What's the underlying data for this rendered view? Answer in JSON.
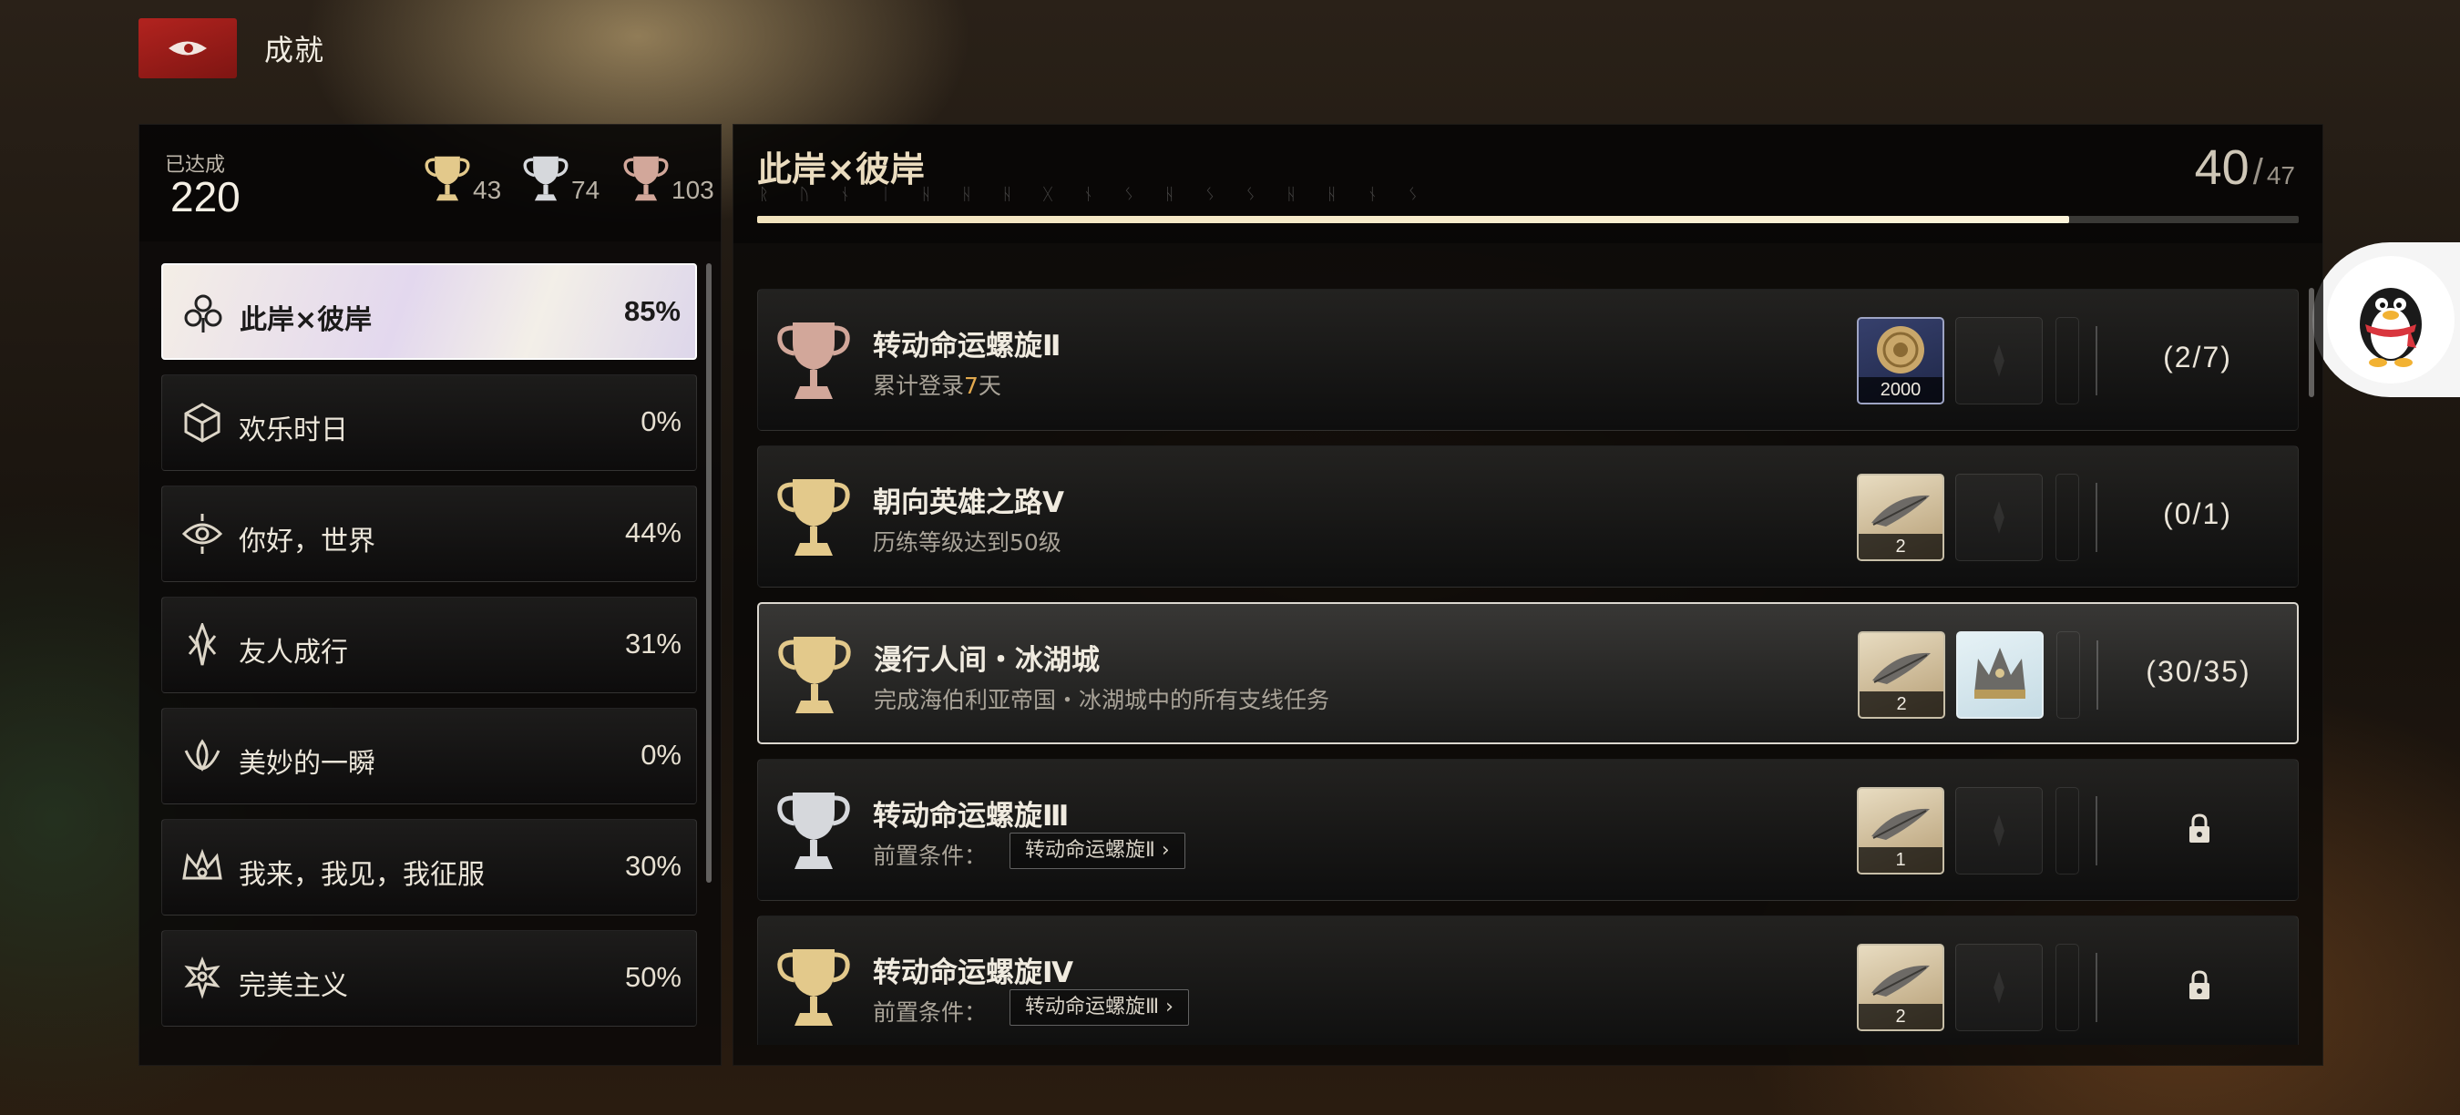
{
  "topbar": {
    "title": "成就"
  },
  "summary": {
    "label": "已达成",
    "total": "220",
    "gold_count": "43",
    "silver_count": "74",
    "bronze_count": "103"
  },
  "categories": [
    {
      "name": "此岸×彼岸",
      "percent": "85%",
      "icon": "clover-star-icon",
      "active": true
    },
    {
      "name": "欢乐时日",
      "percent": "0%",
      "icon": "dice-icon",
      "active": false
    },
    {
      "name": "你好，世界",
      "percent": "44%",
      "icon": "compass-eye-icon",
      "active": false
    },
    {
      "name": "友人成行",
      "percent": "31%",
      "icon": "blade-crest-icon",
      "active": false
    },
    {
      "name": "美妙的一瞬",
      "percent": "0%",
      "icon": "lotus-icon",
      "active": false
    },
    {
      "name": "我来，我见，我征服",
      "percent": "30%",
      "icon": "crown-icon",
      "active": false
    },
    {
      "name": "完美主义",
      "percent": "50%",
      "icon": "ornament-icon",
      "active": false
    }
  ],
  "header": {
    "title": "此岸×彼岸",
    "runes": "ᚱ ᚢ ᚾ ᛁ ᚺ ᚺ ᚺ ᚷ   ᚾ ᛊ ᚺ   ᛊ ᛊ ᚺ ᚺ ᚾ ᛊ",
    "completed": "40",
    "separator": "/",
    "total": "47",
    "progress": 0.851
  },
  "achievements": [
    {
      "name": "转动命运螺旋Ⅱ",
      "desc_pre": "累计登录",
      "desc_hl": "7",
      "desc_post": "天",
      "trophy": "bronze",
      "reward1": {
        "kind": "coin",
        "qty": "2000",
        "icon": "gold-coin-icon"
      },
      "reward2": {
        "kind": "empty",
        "icon": "empty-slot-icon"
      },
      "progress": "(2/7)",
      "locked": false,
      "selected": false
    },
    {
      "name": "朝向英雄之路Ⅴ",
      "desc": "历练等级达到50级",
      "trophy": "gold",
      "reward1": {
        "kind": "item",
        "qty": "2",
        "icon": "feather-quill-icon"
      },
      "reward2": {
        "kind": "empty",
        "icon": "empty-slot-icon"
      },
      "progress": "(0/1)",
      "locked": false,
      "selected": false
    },
    {
      "name": "漫行人间・冰湖城",
      "desc": "完成海伯利亚帝国・冰湖城中的所有支线任务",
      "trophy": "gold",
      "reward1": {
        "kind": "item",
        "qty": "2",
        "icon": "feather-quill-icon"
      },
      "reward2": {
        "kind": "crown",
        "icon": "ice-crown-icon"
      },
      "progress": "(30/35)",
      "locked": false,
      "selected": true
    },
    {
      "name": "转动命运螺旋Ⅲ",
      "prereq_label": "前置条件：",
      "prereq": "转动命运螺旋Ⅱ ›",
      "trophy": "silver",
      "reward1": {
        "kind": "item",
        "qty": "1",
        "icon": "feather-quill-icon"
      },
      "reward2": {
        "kind": "empty",
        "icon": "empty-slot-icon"
      },
      "locked": true,
      "selected": false
    },
    {
      "name": "转动命运螺旋Ⅳ",
      "prereq_label": "前置条件：",
      "prereq": "转动命运螺旋Ⅲ ›",
      "trophy": "gold",
      "reward1": {
        "kind": "item",
        "qty": "2",
        "icon": "feather-quill-icon"
      },
      "reward2": {
        "kind": "empty",
        "icon": "empty-slot-icon"
      },
      "locked": true,
      "selected": false
    }
  ],
  "colors": {
    "back_button": "#9e1c18",
    "gold": "#e3c98b",
    "silver": "#d6d8dc",
    "bronze": "#d2a79a",
    "highlight": "#e2a94e"
  }
}
